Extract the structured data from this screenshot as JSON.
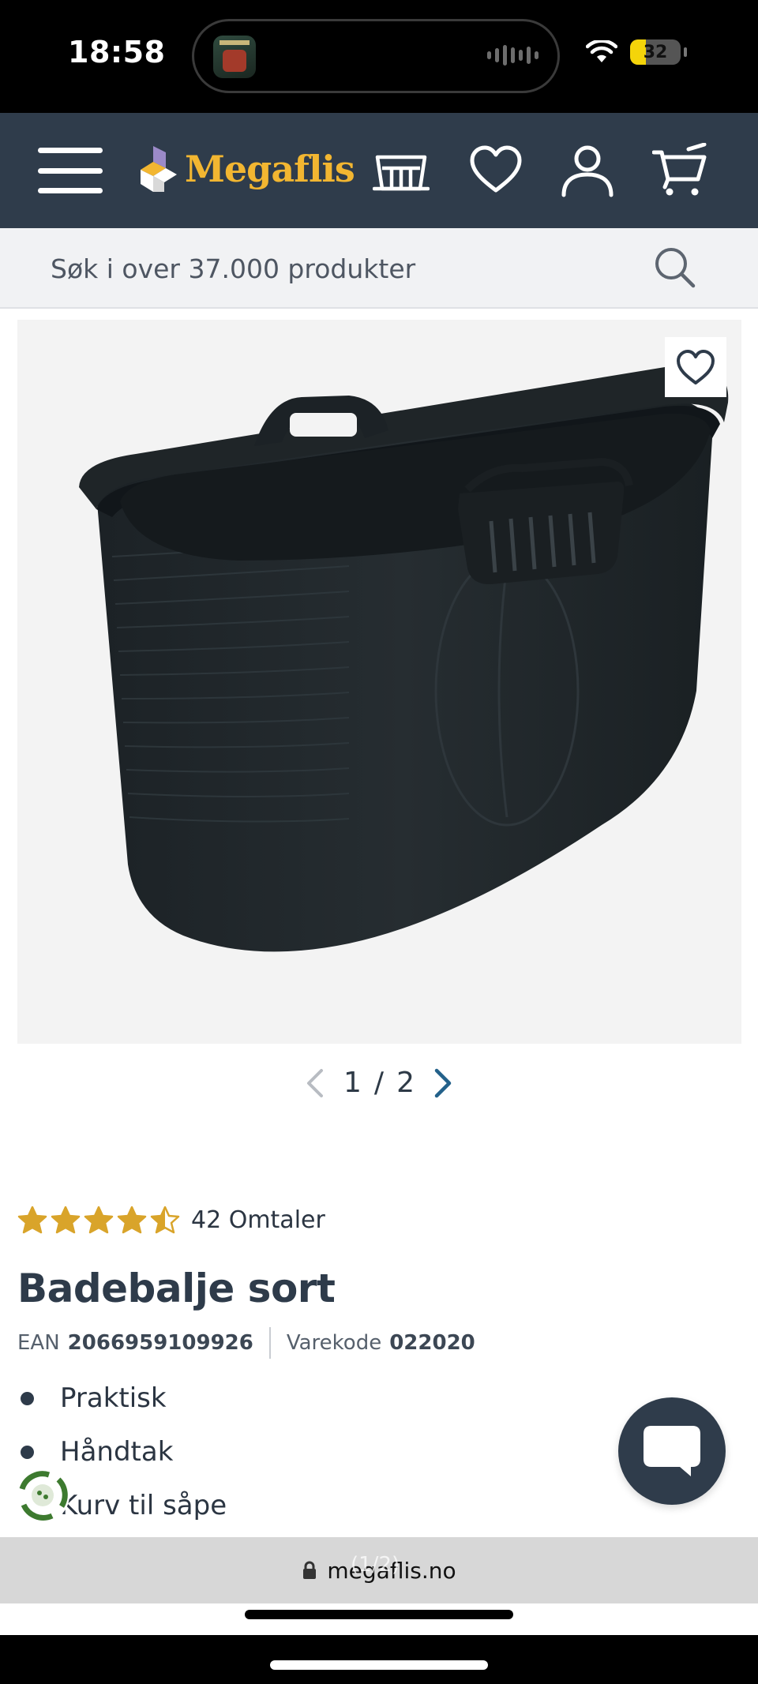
{
  "status_bar": {
    "time": "18:58",
    "battery_level": "32",
    "battery_fraction": 0.32,
    "icons": [
      "wifi-icon",
      "battery-icon",
      "audio-wave-icon"
    ]
  },
  "header": {
    "brand": "Megaflis",
    "brand_color": "#f2b631",
    "background_color": "#2f3c4b",
    "icons": [
      "menu-icon",
      "store-icon",
      "heart-icon",
      "user-icon",
      "cart-icon"
    ]
  },
  "search": {
    "placeholder": "Søk i over 37.000 produkter"
  },
  "gallery": {
    "current": "1",
    "separator": "/",
    "total": "2"
  },
  "product": {
    "rating": 4.5,
    "reviews_text": "42 Omtaler",
    "title": "Badebalje sort",
    "ean_label": "EAN",
    "ean_value": "2066959109926",
    "sku_label": "Varekode",
    "sku_value": "022020",
    "features": [
      "Praktisk",
      "Håndtak",
      "Kurv til såpe"
    ]
  },
  "browser": {
    "url": "megaflis.no",
    "overlay_text": "(1/2)"
  }
}
